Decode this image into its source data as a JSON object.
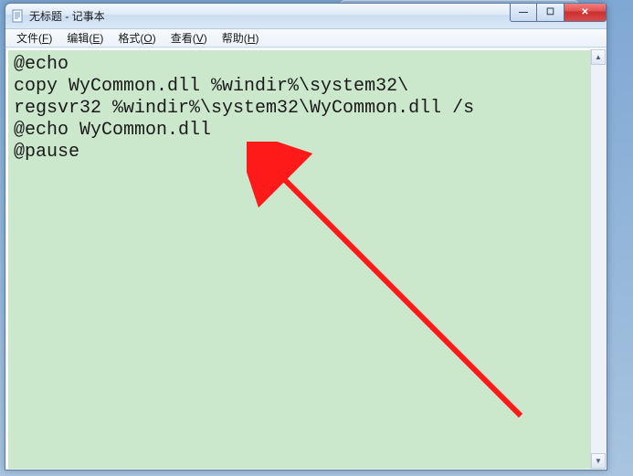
{
  "titlebar": {
    "document_name": "无标题",
    "separator": " - ",
    "app_name": "记事本"
  },
  "window_controls": {
    "minimize_glyph": "—",
    "maximize_glyph": "☐",
    "close_glyph": "✕"
  },
  "menu": {
    "file": {
      "label": "文件",
      "hotkey": "F"
    },
    "edit": {
      "label": "编辑",
      "hotkey": "E"
    },
    "format": {
      "label": "格式",
      "hotkey": "O"
    },
    "view": {
      "label": "查看",
      "hotkey": "V"
    },
    "help": {
      "label": "帮助",
      "hotkey": "H"
    }
  },
  "editor": {
    "lines": [
      "@echo",
      "copy WyCommon.dll %windir%\\system32\\",
      "regsvr32 %windir%\\system32\\WyCommon.dll /s",
      "@echo WyCommon.dll",
      "@pause"
    ]
  },
  "annotation": {
    "arrow_color": "#ff1a1a"
  }
}
